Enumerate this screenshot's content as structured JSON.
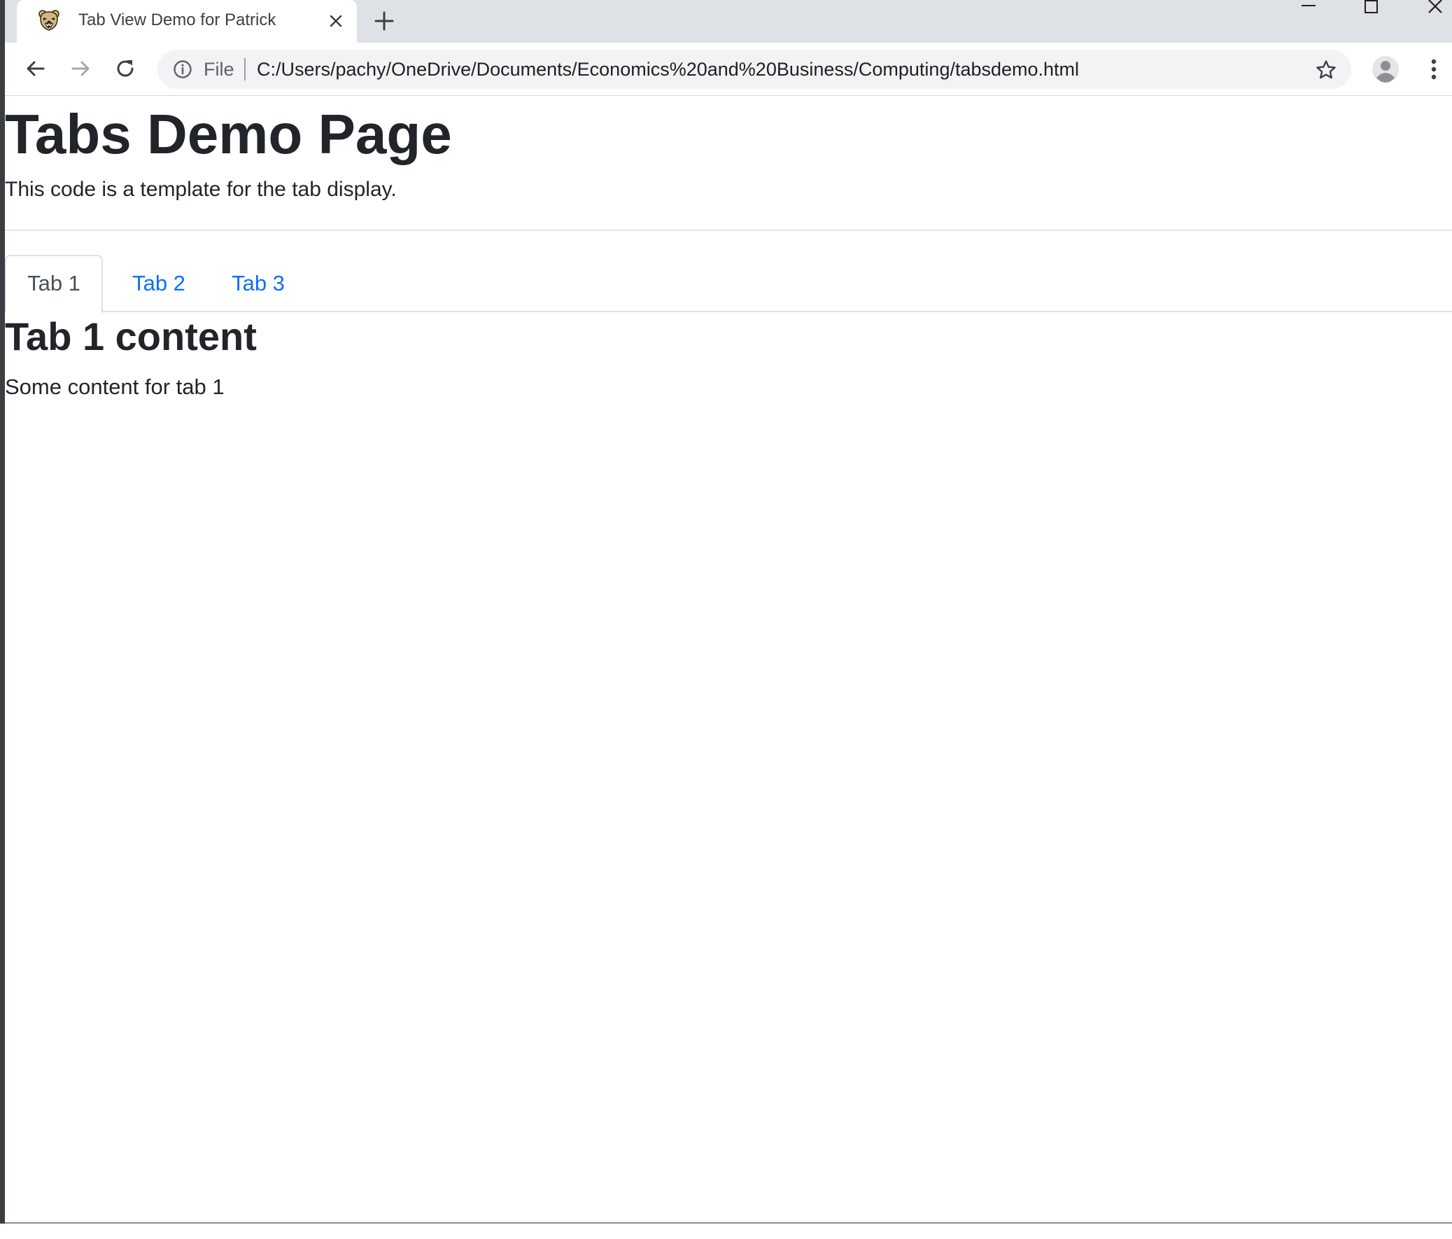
{
  "browser": {
    "tab_title": "Tab View Demo for Patrick",
    "url_scheme_label": "File",
    "url": "C:/Users/pachy/OneDrive/Documents/Economics%20and%20Business/Computing/tabsdemo.html"
  },
  "page": {
    "title": "Tabs Demo Page",
    "lead": "This code is a template for the tab display.",
    "tabs": [
      {
        "label": "Tab 1",
        "active": true
      },
      {
        "label": "Tab 2",
        "active": false
      },
      {
        "label": "Tab 3",
        "active": false
      }
    ],
    "content": {
      "heading": "Tab 1 content",
      "body": "Some content for tab 1"
    }
  },
  "icons": {
    "favicon": "bear-logo-icon",
    "tab_close": "close-icon",
    "new_tab": "plus-icon",
    "back": "arrow-left-icon",
    "forward": "arrow-right-icon",
    "reload": "reload-icon",
    "site_info": "info-icon",
    "bookmark": "star-icon",
    "profile": "avatar-icon",
    "menu": "kebab-menu-icon"
  },
  "colors": {
    "tabstrip": "#dee1e6",
    "link": "#0d6efd",
    "active_tab_text": "#495057",
    "text": "#212529"
  }
}
